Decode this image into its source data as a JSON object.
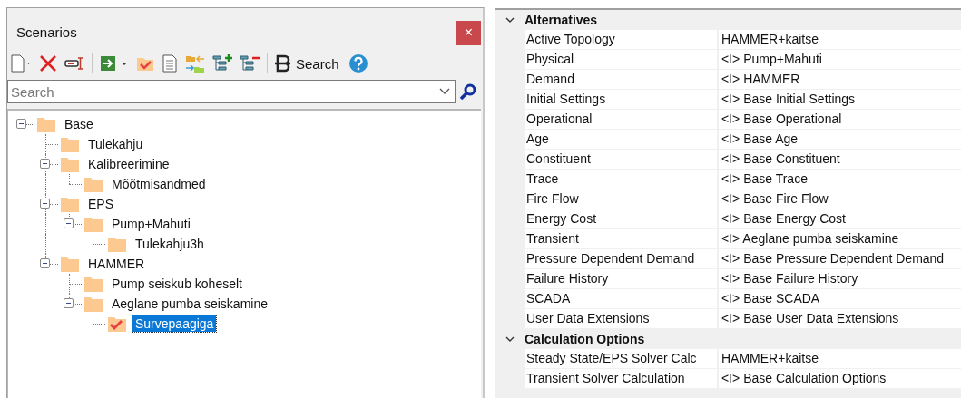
{
  "panel": {
    "title": "Scenarios",
    "close": "×"
  },
  "toolbar": {
    "search_button": "Search"
  },
  "search": {
    "placeholder": "Search"
  },
  "tree": [
    {
      "label": "Base",
      "expanded": true,
      "selected": false,
      "active": false,
      "children": [
        {
          "label": "Tulekahju",
          "selected": false,
          "active": false
        },
        {
          "label": "Kalibreerimine",
          "expanded": true,
          "selected": false,
          "active": false,
          "children": [
            {
              "label": "Mõõtmisandmed",
              "selected": false,
              "active": false
            }
          ]
        },
        {
          "label": "EPS",
          "expanded": true,
          "selected": false,
          "active": false,
          "children": [
            {
              "label": "Pump+Mahuti",
              "expanded": true,
              "selected": false,
              "active": false,
              "children": [
                {
                  "label": "Tulekahju3h",
                  "selected": false,
                  "active": false
                }
              ]
            }
          ]
        },
        {
          "label": "HAMMER",
          "expanded": true,
          "selected": false,
          "active": false,
          "children": [
            {
              "label": "Pump seiskub koheselt",
              "selected": false,
              "active": false
            },
            {
              "label": "Aeglane pumba seiskamine",
              "expanded": true,
              "selected": false,
              "active": false,
              "children": [
                {
                  "label": "Survepaagiga",
                  "selected": true,
                  "active": true
                }
              ]
            }
          ]
        }
      ]
    }
  ],
  "properties": [
    {
      "title": "Alternatives",
      "expanded": true,
      "rows": [
        {
          "label": "Active Topology",
          "value": "HAMMER+kaitse"
        },
        {
          "label": "Physical",
          "value": "<I> Pump+Mahuti"
        },
        {
          "label": "Demand",
          "value": "<I> HAMMER"
        },
        {
          "label": "Initial Settings",
          "value": "<I> Base Initial Settings"
        },
        {
          "label": "Operational",
          "value": "<I> Base Operational"
        },
        {
          "label": "Age",
          "value": "<I> Base Age"
        },
        {
          "label": "Constituent",
          "value": "<I> Base Constituent"
        },
        {
          "label": "Trace",
          "value": "<I> Base Trace"
        },
        {
          "label": "Fire Flow",
          "value": "<I> Base Fire Flow"
        },
        {
          "label": "Energy Cost",
          "value": "<I> Base Energy Cost"
        },
        {
          "label": "Transient",
          "value": "<I> Aeglane pumba seiskamine"
        },
        {
          "label": "Pressure Dependent Demand",
          "value": "<I> Base Pressure Dependent Demand"
        },
        {
          "label": "Failure History",
          "value": "<I> Base Failure History"
        },
        {
          "label": "SCADA",
          "value": "<I> Base SCADA"
        },
        {
          "label": "User Data Extensions",
          "value": "<I> Base User Data Extensions"
        }
      ]
    },
    {
      "title": "Calculation Options",
      "expanded": true,
      "rows": [
        {
          "label": "Steady State/EPS Solver Calc",
          "value": "HAMMER+kaitse"
        },
        {
          "label": "Transient Solver Calculation",
          "value": "<I> Base Calculation Options"
        }
      ]
    }
  ]
}
